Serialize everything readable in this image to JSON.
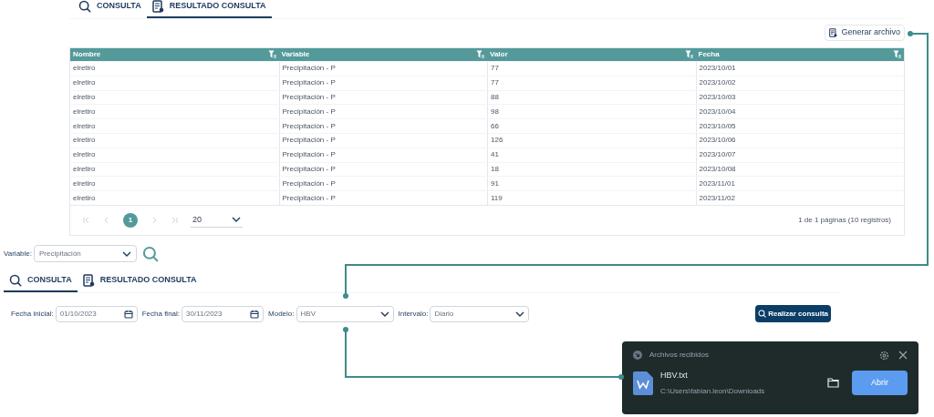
{
  "result_panel": {
    "tabs": [
      {
        "label": "CONSULTA",
        "kind": "search",
        "selected": false
      },
      {
        "label": "RESULTADO CONSULTA",
        "kind": "report",
        "selected": true
      }
    ],
    "generate_button": "Generar archivo",
    "table": {
      "columns": [
        "Nombre",
        "Variable",
        "Valor",
        "Fecha"
      ],
      "rows": [
        [
          "elretiro",
          "Precipitación - P",
          "77",
          "2023/10/01"
        ],
        [
          "elretiro",
          "Precipitación - P",
          "77",
          "2023/10/02"
        ],
        [
          "elretiro",
          "Precipitación - P",
          "88",
          "2023/10/03"
        ],
        [
          "elretiro",
          "Precipitación - P",
          "98",
          "2023/10/04"
        ],
        [
          "elretiro",
          "Precipitación - P",
          "66",
          "2023/10/05"
        ],
        [
          "elretiro",
          "Precipitación - P",
          "126",
          "2023/10/06"
        ],
        [
          "elretiro",
          "Precipitación - P",
          "41",
          "2023/10/07"
        ],
        [
          "elretiro",
          "Precipitación - P",
          "18",
          "2023/10/08"
        ],
        [
          "elretiro",
          "Precipitación - P",
          "91",
          "2023/11/01"
        ],
        [
          "elretiro",
          "Precipitación - P",
          "119",
          "2023/11/02"
        ]
      ]
    },
    "pagination": {
      "pages": [
        {
          "label": "1",
          "selected": true
        }
      ],
      "page_size": "20",
      "summary": "1 de 1 páginas (10 registros)"
    }
  },
  "variable_filter": {
    "label": "Variable:",
    "value": "Precipitación"
  },
  "query_panel": {
    "tabs": [
      {
        "label": "CONSULTA",
        "kind": "search",
        "selected": true
      },
      {
        "label": "RESULTADO CONSULTA",
        "kind": "report",
        "selected": false
      }
    ],
    "fields": [
      {
        "label": "Fecha inicial:",
        "value": "01/10/2023",
        "kind": "date"
      },
      {
        "label": "Fecha final:",
        "value": "30/11/2023",
        "kind": "date"
      },
      {
        "label": "Modelo:",
        "value": "HBV",
        "kind": "select"
      },
      {
        "label": "Intervalo:",
        "value": "Diario",
        "kind": "select"
      }
    ],
    "submit_button": "Realizar consulta"
  },
  "download_notification": {
    "title": "Archivos recibidos",
    "file_name": "HBV.txt",
    "path": "C:\\Users\\fabian.leon\\Downloads",
    "open_button": "Abrir"
  }
}
